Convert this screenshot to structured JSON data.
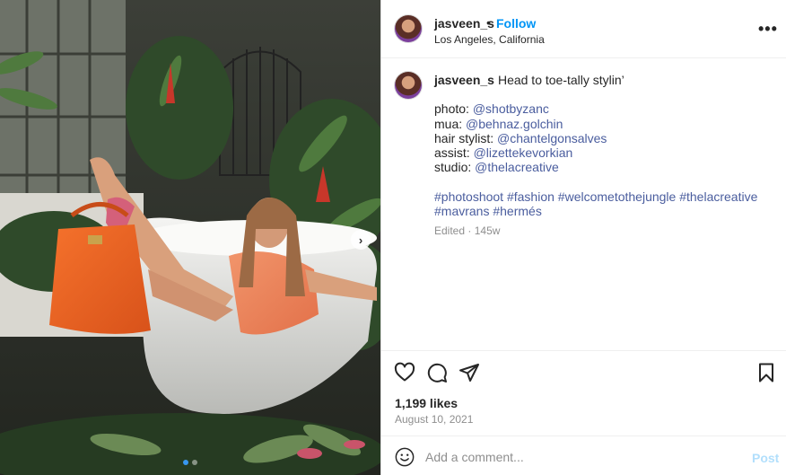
{
  "post": {
    "username": "jasveen_s",
    "separator": "•",
    "follow_label": "Follow",
    "location": "Los Angeles, California",
    "more_label": "•••"
  },
  "caption": {
    "username": "jasveen_s",
    "headline": "Head to toe-tally stylin’",
    "credits": [
      {
        "label": "photo:",
        "handle": "@shotbyzanc"
      },
      {
        "label": "mua:",
        "handle": "@behnaz.golchin"
      },
      {
        "label": "hair stylist:",
        "handle": "@chantelgonsalves"
      },
      {
        "label": "assist:",
        "handle": "@lizettekevorkian"
      },
      {
        "label": "studio:",
        "handle": "@thelacreative"
      }
    ],
    "hashtags_line1": [
      "#photoshoot",
      "#fashion",
      "#welcometothejungle",
      "#thelacreative"
    ],
    "hashtags_line2": [
      "#mavrans",
      "#hermés"
    ],
    "edited": "Edited",
    "meta_sep": "·",
    "age": "145w"
  },
  "stats": {
    "likes": "1,199 likes",
    "date": "August 10, 2021"
  },
  "comment": {
    "placeholder": "Add a comment...",
    "post_label": "Post"
  },
  "carousel": {
    "next_arrow": "›",
    "slide_count": 2,
    "active_slide": 1
  },
  "icons": {
    "like": "heart-icon",
    "comment": "comment-bubble-icon",
    "share": "paper-plane-icon",
    "save": "bookmark-icon",
    "emoji": "emoji-smiley-icon"
  },
  "colors": {
    "follow": "#0095f6",
    "mention": "#4a5d9e",
    "muted": "#8e8e8e",
    "post_disabled": "#b2dffc",
    "carousel_active": "#3897f0"
  }
}
